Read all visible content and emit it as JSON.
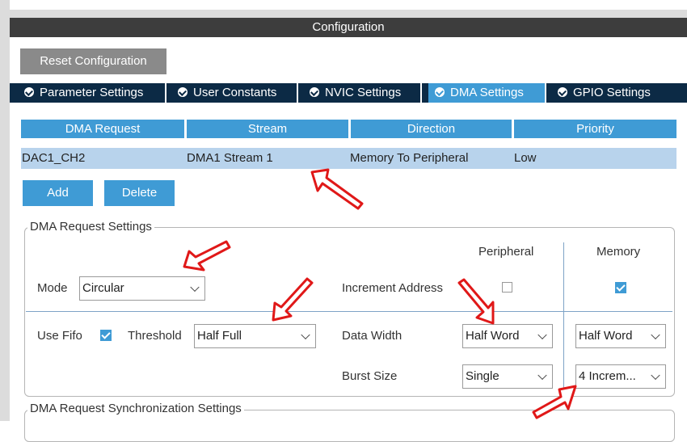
{
  "window": {
    "title": "Configuration"
  },
  "toolbar": {
    "reset_label": "Reset Configuration"
  },
  "tabs": [
    {
      "label": "Parameter Settings"
    },
    {
      "label": "User Constants"
    },
    {
      "label": "NVIC Settings"
    },
    {
      "label": "DMA Settings"
    },
    {
      "label": "GPIO Settings"
    }
  ],
  "dma_table": {
    "columns": [
      "DMA Request",
      "Stream",
      "Direction",
      "Priority"
    ],
    "rows": [
      {
        "request": "DAC1_CH2",
        "stream": "DMA1 Stream 1",
        "direction": "Memory To Peripheral",
        "priority": "Low"
      }
    ]
  },
  "actions": {
    "add_label": "Add",
    "delete_label": "Delete"
  },
  "request_settings": {
    "legend": "DMA Request Settings",
    "peripheral_header": "Peripheral",
    "memory_header": "Memory",
    "mode_label": "Mode",
    "mode_value": "Circular",
    "increment_label": "Increment Address",
    "increment_peripheral_checked": false,
    "increment_memory_checked": true,
    "use_fifo_label": "Use Fifo",
    "use_fifo_checked": true,
    "threshold_label": "Threshold",
    "threshold_value": "Half Full",
    "data_width_label": "Data Width",
    "data_width_peripheral": "Half Word",
    "data_width_memory": "Half Word",
    "burst_size_label": "Burst Size",
    "burst_peripheral": "Single",
    "burst_memory": "4 Increm..."
  },
  "sync_settings": {
    "legend": "DMA Request Synchronization Settings"
  },
  "colors": {
    "accent": "#3f9bd5",
    "tab_bar": "#0c2a45",
    "title_bar": "#3d3d3d",
    "annotation": "#e01818"
  }
}
